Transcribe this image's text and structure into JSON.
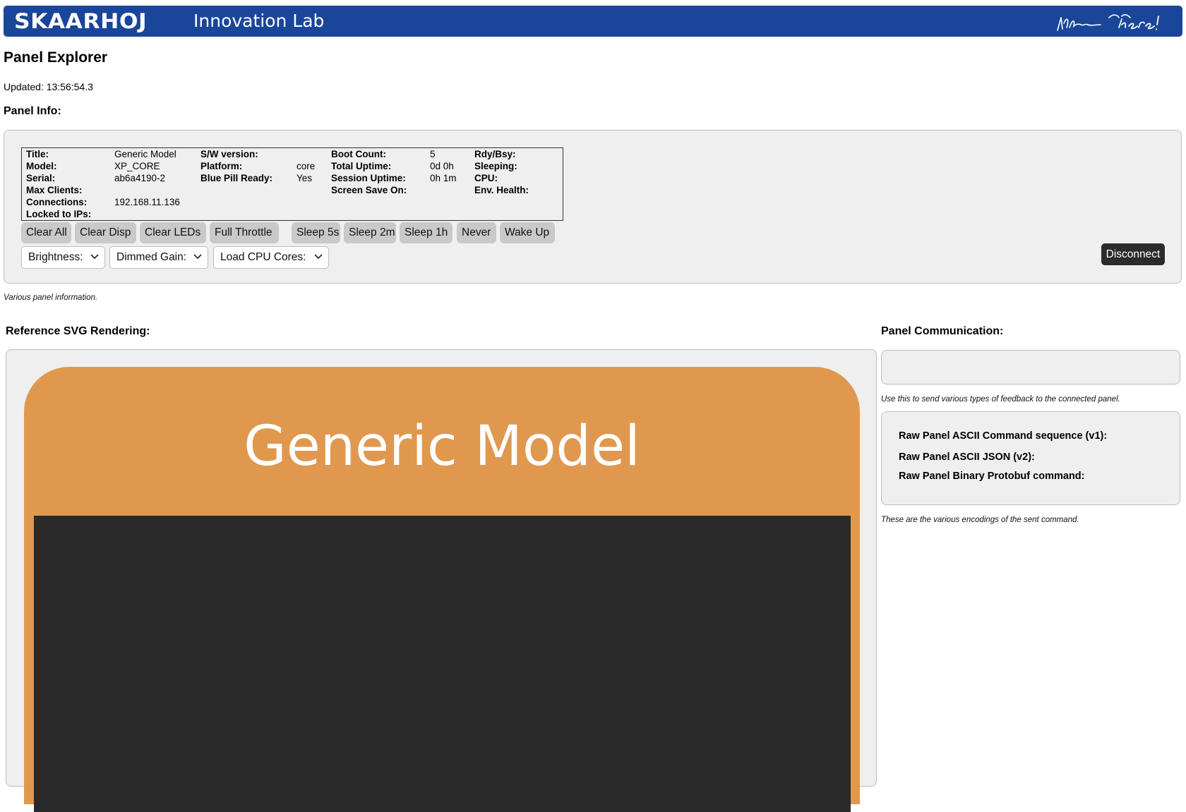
{
  "header": {
    "logo": "SKAARHOJ",
    "title": "Innovation Lab"
  },
  "page": {
    "title": "Panel Explorer",
    "updated": "Updated: 13:56:54.3"
  },
  "panel_info": {
    "heading": "Panel Info:",
    "fields": {
      "title_label": "Title:",
      "title_value": "Generic Model",
      "model_label": "Model:",
      "model_value": "XP_CORE",
      "serial_label": "Serial:",
      "serial_value": "ab6a4190-2",
      "max_clients_label": "Max Clients:",
      "connections_label": "Connections:",
      "connections_value": "192.168.11.136",
      "locked_label": "Locked to IPs:",
      "sw_label": "S/W version:",
      "platform_label": "Platform:",
      "platform_value": "core",
      "bluepill_label": "Blue Pill Ready:",
      "bluepill_value": "Yes",
      "boot_label": "Boot Count:",
      "boot_value": "5",
      "total_uptime_label": "Total Uptime:",
      "total_uptime_value": "0d 0h",
      "session_uptime_label": "Session Uptime:",
      "session_uptime_value": "0h 1m",
      "screensave_label": "Screen Save On:",
      "rdy_label": "Rdy/Bsy:",
      "sleeping_label": "Sleeping:",
      "cpu_label": "CPU:",
      "env_label": "Env. Health:"
    },
    "buttons": [
      "Clear All",
      "Clear Disp",
      "Clear LEDs",
      "Full Throttle",
      "Sleep 5s",
      "Sleep 2m",
      "Sleep 1h",
      "Never",
      "Wake Up"
    ],
    "selects": [
      "Brightness:",
      "Dimmed Gain:",
      "Load CPU Cores:"
    ],
    "disconnect": "Disconnect",
    "caption": "Various panel information."
  },
  "svg_rendering": {
    "heading": "Reference SVG Rendering:",
    "model_title": "Generic Model",
    "colors": {
      "body": "#e0984f",
      "screen": "#2a2a2a"
    }
  },
  "communication": {
    "heading": "Panel Communication:",
    "input_caption": "Use this to send various types of feedback to the connected panel.",
    "raw_lines": [
      "Raw Panel ASCII Command sequence (v1):",
      "Raw Panel ASCII JSON (v2):",
      "Raw Panel Binary Protobuf command:"
    ],
    "raw_caption": "These are the various encodings of the sent command."
  }
}
